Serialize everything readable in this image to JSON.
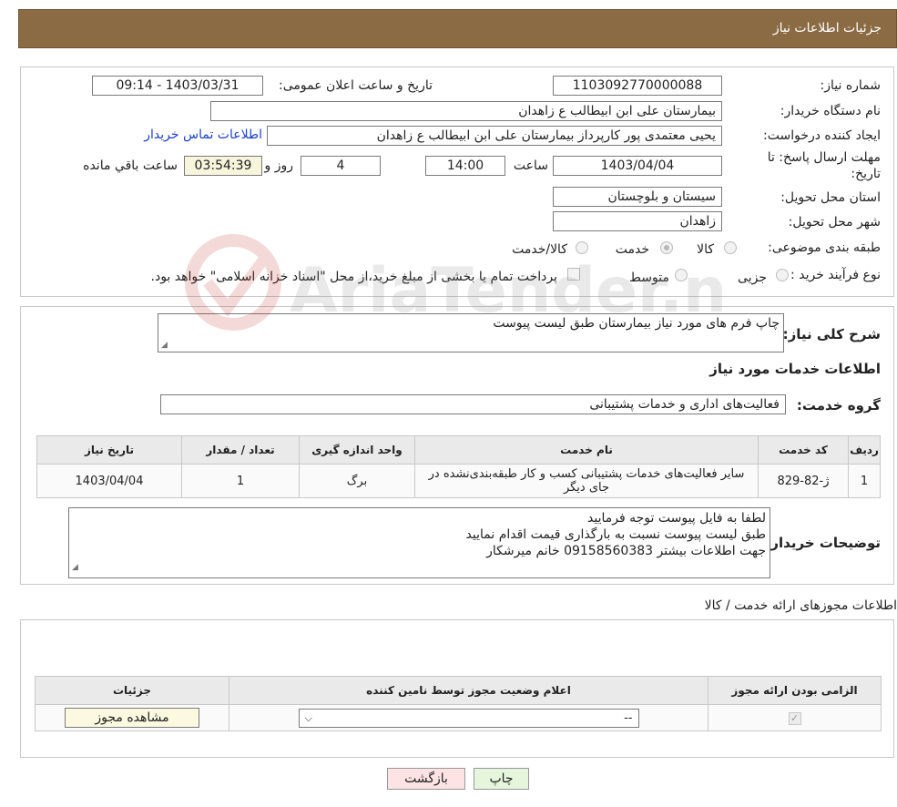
{
  "header": {
    "title": "جزئیات اطلاعات نیاز"
  },
  "form": {
    "need_number_label": "شماره نیاز:",
    "need_number": "1103092770000088",
    "announce_label": "تاریخ و ساعت اعلان عمومی:",
    "announce_value": "1403/03/31 - 09:14",
    "buyer_org_label": "نام دستگاه خریدار:",
    "buyer_org": "بیمارستان علی ابن ابیطالب  ع  زاهدان",
    "creator_label": "ایجاد کننده درخواست:",
    "creator": "یحیی معتمدی پور کارپرداز بیمارستان علی ابن ابیطالب  ع  زاهدان",
    "contact_link": "اطلاعات تماس خریدار",
    "deadline_label_line1": "مهلت ارسال پاسخ: تا",
    "deadline_label_line2": "تاریخ:",
    "deadline_date": "1403/04/04",
    "time_label": "ساعت",
    "deadline_time": "14:00",
    "days_value": "4",
    "days_label": "روز و",
    "remaining_time": "03:54:39",
    "remaining_label": "ساعت باقي مانده",
    "province_label": "استان محل تحویل:",
    "province": "سیستان و بلوچستان",
    "city_label": "شهر محل تحویل:",
    "city": "زاهدان",
    "category_label": "طبقه بندی موضوعی:",
    "category_options": [
      "کالا",
      "خدمت",
      "کالا/خدمت"
    ],
    "category_selected": "خدمت",
    "process_label": "نوع فرآیند خرید :",
    "process_options": [
      "جزیی",
      "متوسط"
    ],
    "payment_note": "پرداخت تمام یا بخشی از مبلغ خرید،از محل \"اسناد خزانه اسلامی\" خواهد بود."
  },
  "summary": {
    "description_label": "شرح کلی نیاز:",
    "description": "چاپ فرم های مورد نیاز بیمارستان طبق لیست پیوست",
    "services_heading": "اطلاعات خدمات مورد نیاز",
    "service_group_label": "گروه خدمت:",
    "service_group": "فعالیت‌های اداری و خدمات پشتیبانی"
  },
  "services_table": {
    "headers": [
      "ردیف",
      "کد خدمت",
      "نام خدمت",
      "واحد اندازه گیری",
      "تعداد / مقدار",
      "تاریخ نیاز"
    ],
    "rows": [
      {
        "row": "1",
        "code": "ژ-82-829",
        "name": "سایر فعالیت‌های خدمات پشتیبانی کسب و کار طبقه‌بندی‌نشده در جای دیگر",
        "unit": "برگ",
        "qty": "1",
        "date": "1403/04/04"
      }
    ]
  },
  "buyer_notes": {
    "label": "توضیحات خریدار:",
    "lines": [
      "لطفا به فایل پیوست توجه فرمایید",
      "طبق لیست پیوست نسبت به بارگذاری قیمت اقدام نمایید",
      "جهت اطلاعات بیشتر 09158560383 خانم میرشکار"
    ]
  },
  "licenses": {
    "heading": "اطلاعات مجوزهای ارائه خدمت / کالا",
    "headers": [
      "الزامی بودن ارائه مجوز",
      "اعلام وضعیت مجوز توسط نامین کننده",
      "جزئیات"
    ],
    "select_value": "--",
    "view_button": "مشاهده مجوز"
  },
  "buttons": {
    "print": "چاپ",
    "back": "بازگشت"
  },
  "watermark_text": "AriaTender.neT",
  "colors": {
    "header_bg": "#8b6b43",
    "back_btn_bg": "#fde3e3",
    "print_btn_bg": "#e6f6dc",
    "link": "#1a3fcc"
  }
}
